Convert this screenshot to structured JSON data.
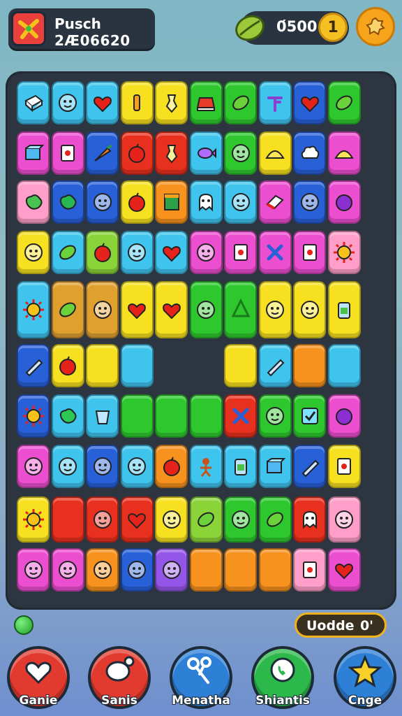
{
  "header": {
    "player_name": "Pusch",
    "score": "2Æ06620",
    "coins": "0́500",
    "coin_badge": "1"
  },
  "footer": {
    "mode_label": "Uodde",
    "mode_value": "0'",
    "nav": [
      {
        "label": "Ganie",
        "color": "#e23a2e",
        "icon": "heart-icon"
      },
      {
        "label": "Sanis",
        "color": "#e23a2e",
        "icon": "chat-icon"
      },
      {
        "label": "Menatha",
        "color": "#2e7fd6",
        "icon": "scissors-icon"
      },
      {
        "label": "Shiantis",
        "color": "#2cb84a",
        "icon": "phone-chat-icon"
      },
      {
        "label": "Cnge",
        "color": "#2e7fd6",
        "icon": "star-icon"
      }
    ]
  },
  "board": {
    "colors": {
      "c": "#3fc4ee",
      "b": "#2860d8",
      "r": "#e8301f",
      "y": "#f6e020",
      "g": "#2ec82e",
      "l": "#8ad43a",
      "p": "#ec4ed0",
      "v": "#9456e8",
      "o": "#f7921e",
      "k": "#ff9ec8",
      "a": "#e0a030",
      "s": "#f7c94a"
    },
    "rows": [
      [
        "c",
        "c",
        "c",
        "y",
        "y",
        "g",
        "g",
        "c",
        "b",
        "g"
      ],
      [
        "p",
        "p",
        "b",
        "r",
        "r",
        "c",
        "g",
        "y",
        "b",
        "p"
      ],
      [
        "k",
        "b",
        "b",
        "y",
        "o",
        "c",
        "c",
        "p",
        "b",
        "p"
      ],
      [
        "y",
        "c",
        "l",
        "c",
        "c",
        "p",
        "p",
        "p",
        "p",
        "k"
      ],
      [
        "c",
        "a",
        "a",
        "y",
        "y",
        "g",
        "g",
        "y",
        "y",
        "y"
      ],
      [
        "b",
        "y",
        "y",
        "c",
        "-",
        "-",
        "y",
        "c",
        "o",
        "c"
      ],
      [
        "b",
        "c",
        "c",
        "g",
        "g",
        "g",
        "r",
        "g",
        "g",
        "p"
      ],
      [
        "p",
        "c",
        "b",
        "c",
        "o",
        "c",
        "c",
        "c",
        "b",
        "y"
      ],
      [
        "y",
        "r",
        "r",
        "r",
        "y",
        "l",
        "g",
        "g",
        "r",
        "k"
      ],
      [
        "p",
        "p",
        "o",
        "b",
        "v",
        "o",
        "o",
        "o",
        "k",
        "p"
      ]
    ],
    "glyphs": [
      [
        "block",
        "face",
        "heart",
        "bar",
        "vase",
        "cake",
        "leaf",
        "tap",
        "heart",
        "leaf"
      ],
      [
        "box",
        "card",
        "carrot",
        "apple",
        "vase",
        "fish",
        "face",
        "hat",
        "cloud",
        "hat"
      ],
      [
        "blob",
        "blob",
        "face",
        "apple",
        "book",
        "ghost",
        "face",
        "eraser",
        "face",
        "plum"
      ],
      [
        "face",
        "leaf",
        "apple",
        "face",
        "heart",
        "face",
        "card",
        "cross",
        "card",
        "sun"
      ],
      [
        "sun",
        "leaf",
        "face",
        "heart",
        "heart",
        "face",
        "tree",
        "face",
        "face",
        "jar"
      ],
      [
        "pencil",
        "apple",
        "",
        "",
        "",
        "",
        "",
        "pencil",
        "",
        ""
      ],
      [
        "sun",
        "blob",
        "cup",
        "",
        "",
        "",
        "cross",
        "face",
        "check",
        "plum"
      ],
      [
        "face",
        "face",
        "face",
        "face",
        "apple",
        "doll",
        "jar",
        "box",
        "pencil",
        "card"
      ],
      [
        "sun",
        "",
        "face",
        "heart",
        "face",
        "leaf",
        "face",
        "leaf",
        "ghost",
        "face"
      ],
      [
        "face",
        "face",
        "face",
        "face",
        "face",
        "",
        "",
        "",
        "card",
        "heart"
      ]
    ]
  }
}
